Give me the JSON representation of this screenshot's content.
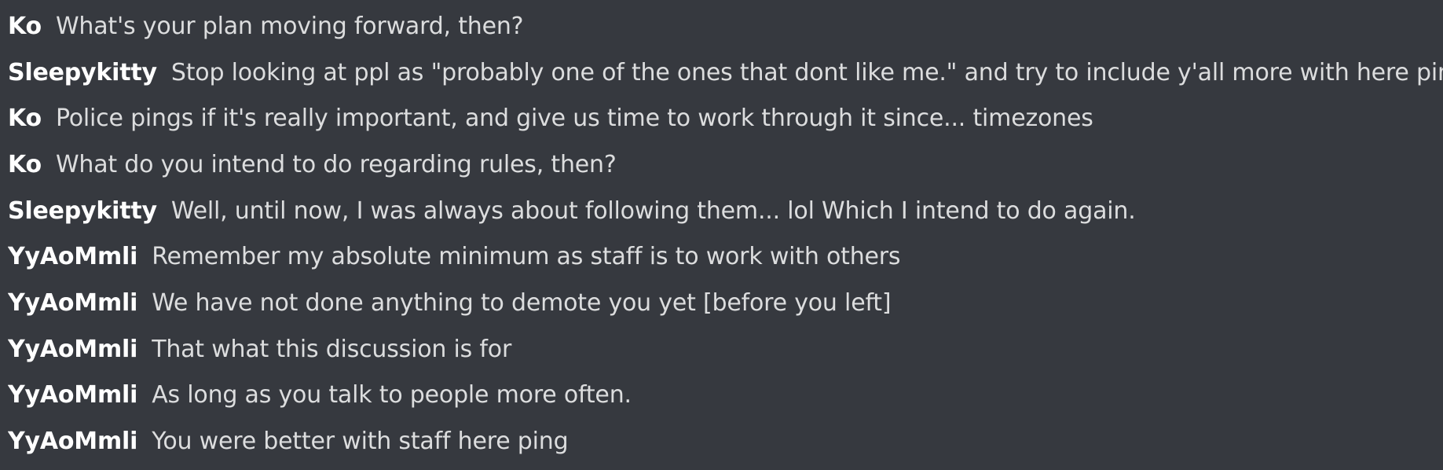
{
  "theme": {
    "background": "#36393f",
    "author_color": "#ffffff",
    "text_color": "#dcddde"
  },
  "messages": [
    {
      "author": "Ko",
      "text": "What's your plan moving forward, then?"
    },
    {
      "author": "Sleepykitty",
      "text": "Stop looking at ppl as \"probably one of the ones that dont like me.\" and try to include y'all more with here pings."
    },
    {
      "author": "Ko",
      "text": "Police pings if it's really important, and give us time to work through it since... timezones"
    },
    {
      "author": "Ko",
      "text": "What do you intend to do regarding rules, then?"
    },
    {
      "author": "Sleepykitty",
      "text": "Well, until now, I was always about following them... lol  Which I intend to do again."
    },
    {
      "author": "YyAoMmli",
      "text": "Remember my absolute minimum as staff is to work with others"
    },
    {
      "author": "YyAoMmli",
      "text": "We have not done anything to demote you yet [before you left]"
    },
    {
      "author": "YyAoMmli",
      "text": "That what this discussion is for"
    },
    {
      "author": "YyAoMmli",
      "text": "As long as you talk to people more often."
    },
    {
      "author": "YyAoMmli",
      "text": "You were better with staff here ping"
    }
  ]
}
